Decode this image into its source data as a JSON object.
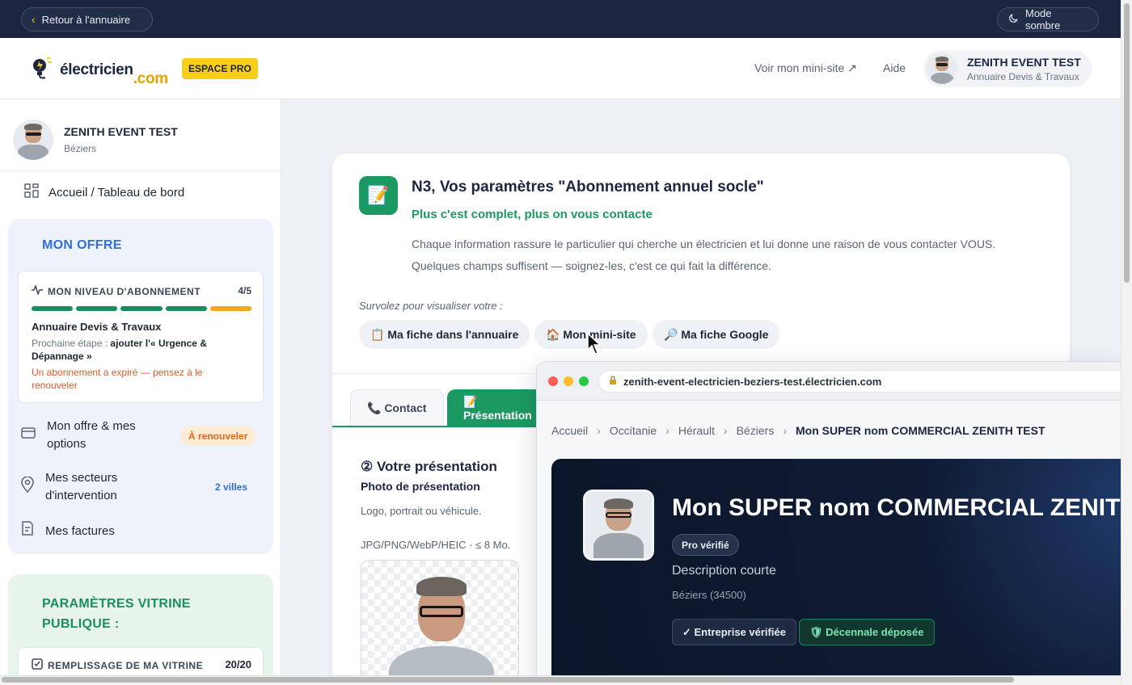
{
  "topbar": {
    "back_label": "Retour à l'annuaire",
    "dark_mode_label": "Mode sombre"
  },
  "header": {
    "logo_main": "électricien",
    "logo_tld": ".com",
    "pro_badge": "ESPACE PRO",
    "minisite_link": "Voir mon mini-site ↗",
    "help_link": "Aide",
    "account_name": "ZENITH EVENT TEST",
    "account_plan": "Annuaire Devis & Travaux"
  },
  "sidebar": {
    "user_name": "ZENITH EVENT TEST",
    "user_city": "Béziers",
    "home_label": "Accueil / Tableau de bord",
    "offer_title": "MON OFFRE",
    "level": {
      "heading": "MON NIVEAU D'ABONNEMENT",
      "count": "4/5",
      "filled_segments": 4,
      "total_segments": 5,
      "plan_name": "Annuaire Devis & Travaux",
      "next_step_prefix": "Prochaine étape : ",
      "next_step_value": "ajouter l'« Urgence & Dépannage »",
      "expired_note": "Un abonnement a expiré — pensez à le renouveler"
    },
    "menu": [
      {
        "label_1": "Mon offre & mes",
        "label_2": "options",
        "badge": "À renouveler"
      },
      {
        "label_1": "Mes secteurs",
        "label_2": "d'intervention",
        "badge": "2 villes"
      },
      {
        "label_1": "Mes factures"
      }
    ],
    "vitrine_title": "PARAMÈTRES VITRINE PUBLIQUE :",
    "fill": {
      "heading": "REMPLISSAGE DE MA VITRINE",
      "count": "20/20"
    }
  },
  "main": {
    "step_title": "N3, Vos paramètres \"Abonnement annuel socle\"",
    "step_subtitle": "Plus c'est complet, plus on vous contacte",
    "step_desc_1": "Chaque information rassure le particulier qui cherche un électricien et lui donne une raison de vous contacter VOUS.",
    "step_desc_2": "Quelques champs suffisent — soignez-les, c'est ce qui fait la différence.",
    "hover_hint": "Survolez pour visualiser votre :",
    "chips": [
      "📋 Ma fiche dans l'annuaire",
      "🏠 Mon mini-site",
      "🔎 Ma fiche Google"
    ],
    "tabs": [
      "📞 Contact",
      "📝 Présentation"
    ],
    "presentation_title": "② Votre présentation",
    "photo_label": "Photo de présentation",
    "photo_help": "Logo, portrait ou véhicule.",
    "photo_formats": "JPG/PNG/WebP/HEIC · ≤ 8 Mo."
  },
  "preview": {
    "url": "zenith-event-electricien-beziers-test.électricien.com",
    "breadcrumb": [
      "Accueil",
      "Occitanie",
      "Hérault",
      "Béziers",
      "Mon SUPER nom COMMERCIAL ZENITH TEST"
    ],
    "hero_title": "Mon SUPER nom COMMERCIAL ZENITH TEST",
    "verified_pill": "Pro vérifié",
    "description": "Description courte",
    "city": "Béziers (34500)",
    "badge_company": "✓ Entreprise vérifiée",
    "badge_decennale": "🛡 Décennale déposée"
  },
  "colors": {
    "brand_navy": "#1c2640",
    "accent_green": "#1a9a62",
    "accent_blue": "#2f6fe0",
    "warning_orange": "#f5a623",
    "pro_yellow": "#f7cf1a"
  }
}
